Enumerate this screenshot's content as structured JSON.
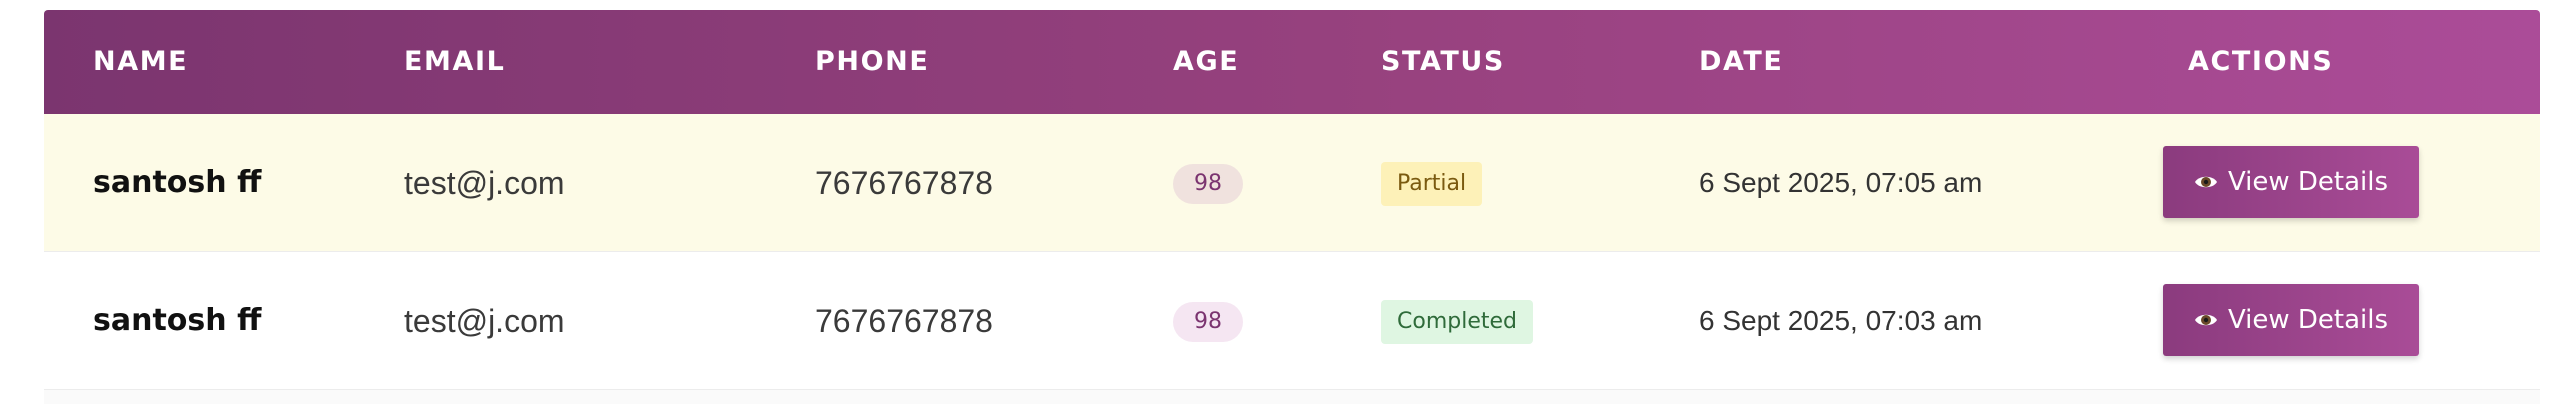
{
  "table": {
    "headers": {
      "name": "NAME",
      "email": "EMAIL",
      "phone": "PHONE",
      "age": "AGE",
      "status": "STATUS",
      "date": "DATE",
      "actions": "ACTIONS"
    },
    "rows": [
      {
        "name": "santosh ff",
        "email": "test@j.com",
        "phone": "7676767878",
        "age": "98",
        "status": "Partial",
        "date": "6 Sept 2025, 07:05 am",
        "action_label": "View Details",
        "action_icon": "eye-icon"
      },
      {
        "name": "santosh ff",
        "email": "test@j.com",
        "phone": "7676767878",
        "age": "98",
        "status": "Completed",
        "date": "6 Sept 2025, 07:03 am",
        "action_label": "View Details",
        "action_icon": "eye-icon"
      }
    ]
  },
  "colors": {
    "header_gradient_start": "#7b356f",
    "header_gradient_end": "#ab4c98",
    "partial_row_background": "#fdfbe7",
    "partial_badge": "#fdf1b8",
    "completed_badge": "#dff6e2",
    "button_accent": "#a94c97"
  }
}
